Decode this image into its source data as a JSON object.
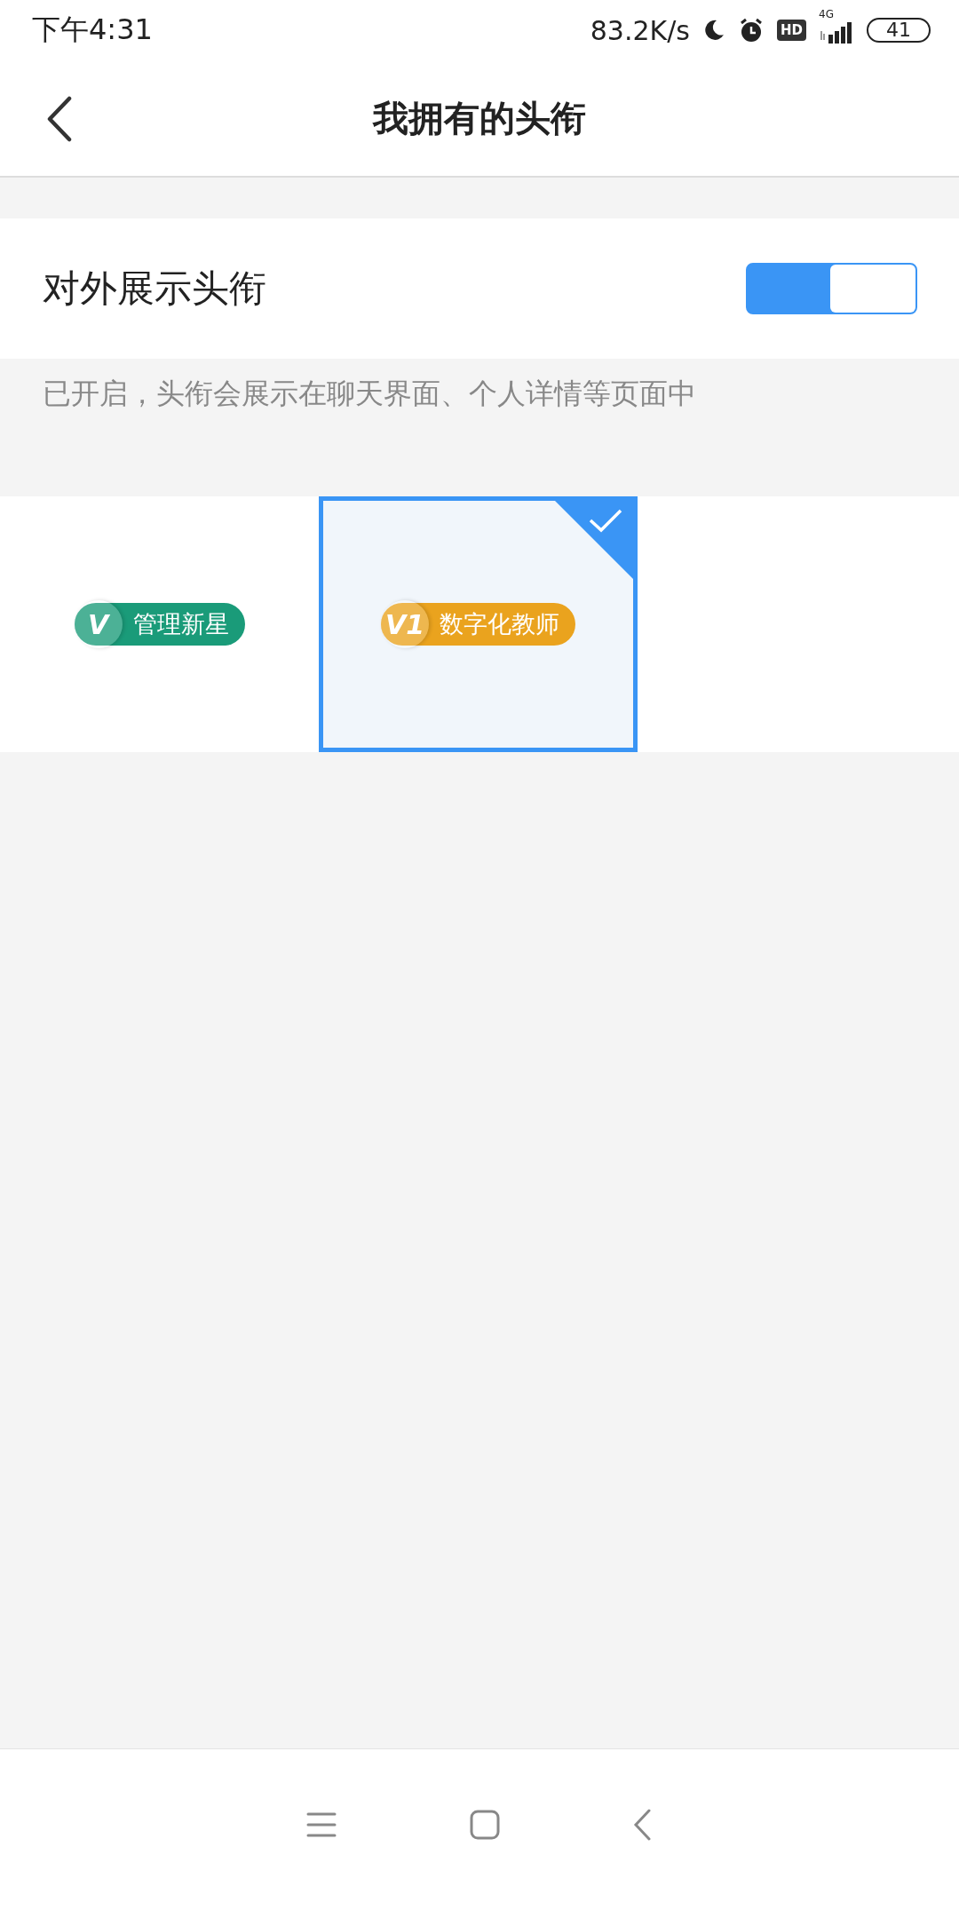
{
  "status_bar": {
    "time": "下午4:31",
    "speed": "83.2K/s",
    "hd": "HD",
    "network": "4G",
    "battery": "41"
  },
  "header": {
    "title": "我拥有的头衔"
  },
  "display_setting": {
    "label": "对外展示头衔",
    "on": true,
    "hint": "已开启，头衔会展示在聊天界面、个人详情等页面中"
  },
  "titles": [
    {
      "mark": "V",
      "name": "管理新星",
      "color": "#1a9b79",
      "selected": false
    },
    {
      "mark": "V1",
      "name": "数字化教师",
      "color": "#eaa31e",
      "selected": true
    }
  ]
}
